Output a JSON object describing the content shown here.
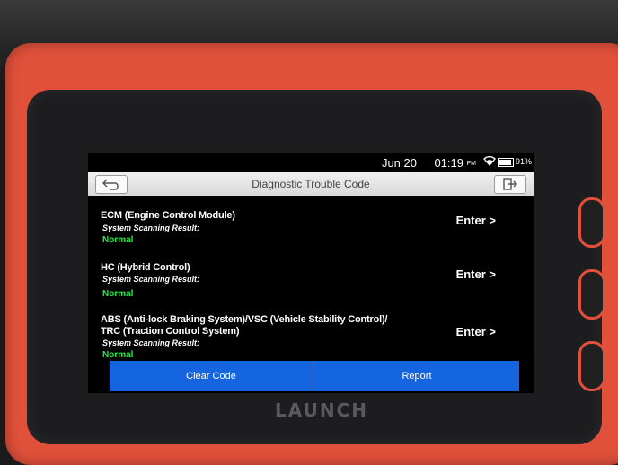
{
  "status_bar": {
    "date": "Jun 20",
    "time": "01:19",
    "ampm": "PM",
    "wifi_icon": "wifi-icon",
    "battery_icon": "battery-icon",
    "battery_percent": "91%",
    "battery_level": 0.91
  },
  "header": {
    "title": "Diagnostic Trouble Code",
    "back_icon": "back-arrow-icon",
    "exit_icon": "exit-icon"
  },
  "modules": [
    {
      "name_line1": "ECM (Engine Control Module)",
      "name_line2": "",
      "scan_label": "System Scanning Result:",
      "result": "Normal",
      "enter_label": "Enter >"
    },
    {
      "name_line1": "HC (Hybrid Control)",
      "name_line2": "",
      "scan_label": "System Scanning Result:",
      "result": "Normal",
      "enter_label": "Enter >"
    },
    {
      "name_line1": "ABS (Anti-lock Braking System)/VSC (Vehicle Stability Control)/",
      "name_line2": "TRC (Traction Control System)",
      "scan_label": "System Scanning Result:",
      "result": "Normal",
      "enter_label": "Enter >"
    }
  ],
  "footer": {
    "clear_code_label": "Clear Code",
    "report_label": "Report"
  },
  "device": {
    "brand": "LAUNCH"
  },
  "colors": {
    "accent_blue": "#1665e0",
    "normal_green": "#25e94a",
    "case_red": "#e0503a"
  }
}
